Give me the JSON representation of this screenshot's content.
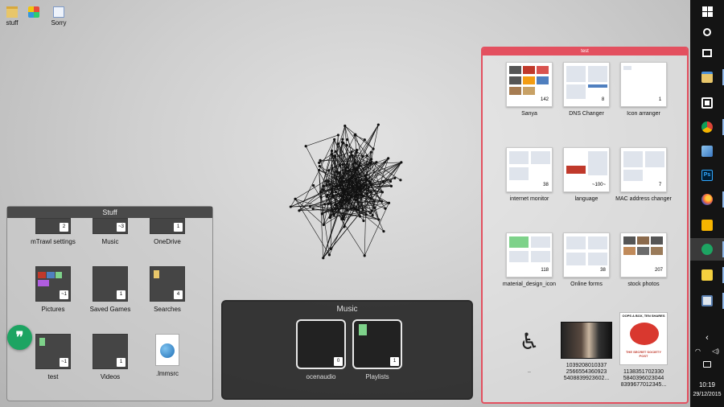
{
  "desktop_icons": [
    {
      "label": "stuff",
      "icon": "folder-icon"
    },
    {
      "label": "",
      "icon": "multicolor-app-icon"
    },
    {
      "label": "Sorry",
      "icon": "document-icon"
    }
  ],
  "fences": {
    "stuff": {
      "title": "Stuff",
      "items": [
        {
          "label": "mTrawl settings",
          "count": "2"
        },
        {
          "label": "Music",
          "count": "~3"
        },
        {
          "label": "OneDrive",
          "count": "1"
        },
        {
          "label": "Pictures",
          "count": "~1"
        },
        {
          "label": "Saved Games",
          "count": "1"
        },
        {
          "label": "Searches",
          "count": "4"
        },
        {
          "label": "test",
          "count": "~1"
        },
        {
          "label": "Videos",
          "count": "1"
        },
        {
          "label": ".lmmsrc",
          "count": ""
        }
      ]
    },
    "music": {
      "title": "Music",
      "items": [
        {
          "label": "ocenaudio",
          "count": "0"
        },
        {
          "label": "Playlists",
          "count": "1"
        }
      ]
    },
    "test": {
      "title": "test",
      "items": [
        {
          "label": "Sanya",
          "count": "142"
        },
        {
          "label": "DNS Changer",
          "count": "8"
        },
        {
          "label": "Icon arranger",
          "count": "1"
        },
        {
          "label": "internet monitor",
          "count": "38"
        },
        {
          "label": "language",
          "count": "~100~"
        },
        {
          "label": "MAC address changer",
          "count": "7"
        },
        {
          "label": "material_design_icon",
          "count": "118"
        },
        {
          "label": "Online forms",
          "count": "38"
        },
        {
          "label": "stock photos",
          "count": "207"
        },
        {
          "label": "..",
          "count": ""
        },
        {
          "label": "1039208010337 2566554360923 5408839923602...",
          "count": ""
        },
        {
          "label": "1138351702330 5840396023044 8399677012345...",
          "count": ""
        }
      ]
    }
  },
  "meme": {
    "top": "OOPS A BOX, TEN SHARES",
    "bottom": "THE SECRET SOCIETY POST"
  },
  "taskbar": {
    "buttons": [
      {
        "icon": "windows-start-icon"
      },
      {
        "icon": "search-icon"
      },
      {
        "icon": "task-view-icon"
      },
      {
        "icon": "file-explorer-icon"
      },
      {
        "icon": "store-icon"
      },
      {
        "icon": "chrome-icon"
      },
      {
        "icon": "app-icon"
      },
      {
        "icon": "photoshop-icon",
        "text": "Ps"
      },
      {
        "icon": "firefox-icon"
      },
      {
        "icon": "media-player-icon"
      },
      {
        "icon": "hangouts-icon"
      },
      {
        "icon": "sticky-notes-icon"
      },
      {
        "icon": "photo-app-icon"
      }
    ],
    "time": "10:19",
    "date": "29/12/2015"
  },
  "colors": {
    "accent": "#e3505f",
    "taskbar": "#141414",
    "hangouts": "#1da462"
  }
}
